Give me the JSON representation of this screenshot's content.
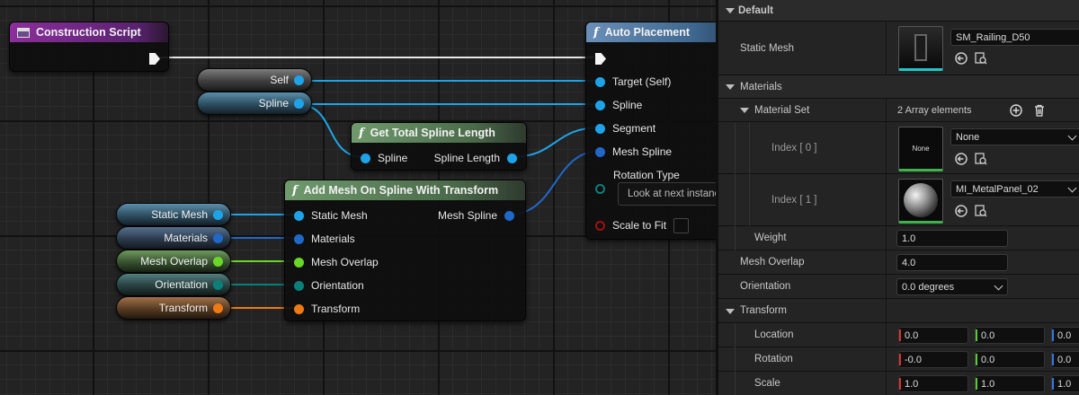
{
  "graph": {
    "construction_script": {
      "title": "Construction Script"
    },
    "self_var": {
      "label": "Self"
    },
    "spline_var": {
      "label": "Spline"
    },
    "get_length": {
      "title": "Get Total Spline Length",
      "in_pin": "Spline",
      "out_pin": "Spline Length"
    },
    "add_mesh": {
      "title": "Add Mesh On Spline With Transform",
      "in_pins": [
        "Static Mesh",
        "Materials",
        "Mesh Overlap",
        "Orientation",
        "Transform"
      ],
      "out_pin": "Mesh Spline"
    },
    "auto_place": {
      "title": "Auto Placement",
      "pins": [
        "Target (Self)",
        "Spline",
        "Segment",
        "Mesh Spline"
      ],
      "rotation_type_label": "Rotation Type",
      "rotation_type_value": "Look at next instance",
      "scale_to_fit_label": "Scale to Fit"
    },
    "left_vars": [
      "Static Mesh",
      "Materials",
      "Mesh Overlap",
      "Orientation",
      "Transform"
    ],
    "colors": {
      "object": "#1fa3e8",
      "array": "#1f68c8",
      "float": "#6bd62a",
      "enum": "#0b7f7a",
      "transform": "#ee7a14",
      "bool": "#a11010",
      "exec": "#f0f0f0"
    }
  },
  "details": {
    "default_section": "Default",
    "static_mesh": {
      "label": "Static Mesh",
      "value": "SM_Railing_D50"
    },
    "materials_section": "Materials",
    "material_set": {
      "label": "Material Set",
      "value": "2 Array elements"
    },
    "index0": {
      "label": "Index [ 0 ]",
      "thumb": "None",
      "value": "None"
    },
    "index1": {
      "label": "Index [ 1 ]",
      "value": "MI_MetalPanel_02"
    },
    "weight": {
      "label": "Weight",
      "value": "1.0"
    },
    "mesh_overlap": {
      "label": "Mesh Overlap",
      "value": "4.0"
    },
    "orientation": {
      "label": "Orientation",
      "value": "0.0 degrees"
    },
    "transform_section": "Transform",
    "location": {
      "label": "Location",
      "x": "0.0",
      "y": "0.0",
      "z": "0.0"
    },
    "rotation": {
      "label": "Rotation",
      "x": "-0.0",
      "y": "0.0",
      "z": "0.0"
    },
    "scale": {
      "label": "Scale",
      "x": "1.0",
      "y": "1.0",
      "z": "1.0"
    }
  }
}
